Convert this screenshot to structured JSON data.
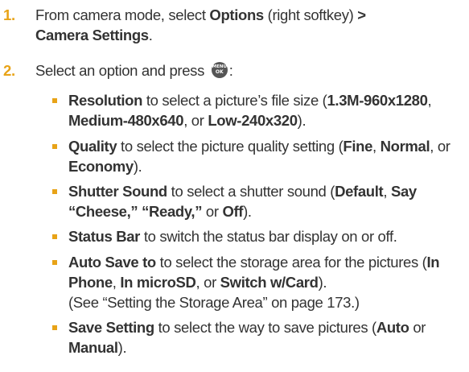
{
  "step1": {
    "number": "1.",
    "text_a": "From camera mode, select ",
    "options": "Options",
    "text_b": " (right softkey) ",
    "arrow": ">",
    "camera_settings": "Camera Settings",
    "period": "."
  },
  "step2": {
    "number": "2.",
    "text_a": "Select an option and press ",
    "key_line1": "MENU",
    "key_line2": "OK",
    "text_b": ":"
  },
  "bullets": {
    "resolution": {
      "title": "Resolution",
      "t1": " to select a picture’s file size (",
      "o1": "1.3M-960x1280",
      "s1": ", ",
      "o2": "Medium-480x640",
      "s2": ", or ",
      "o3": "Low-240x320",
      "end": ")."
    },
    "quality": {
      "title": "Quality",
      "t1": " to select the picture quality setting (",
      "o1": "Fine",
      "s1": ", ",
      "o2": "Normal",
      "s2": ", or ",
      "o3": "Economy",
      "end": ")."
    },
    "shutter": {
      "title": "Shutter Sound",
      "t1": " to select a shutter sound (",
      "o1": "Default",
      "s1": ", ",
      "o2": "Say “Cheese,”",
      "s2": " ",
      "o3": "“Ready,”",
      "s3": " or ",
      "o4": "Off",
      "end": ")."
    },
    "status_bar": {
      "title": "Status Bar",
      "t1": " to switch the status bar display on or off."
    },
    "auto_save": {
      "title": "Auto Save to",
      "t1": " to select the storage area for the pictures (",
      "o1": "In Phone",
      "s1": ", ",
      "o2": "In microSD",
      "s2": ", or ",
      "o3": "Switch w/Card",
      "end": ").",
      "note": "(See “Setting the Storage Area” on page 173.)"
    },
    "save_setting": {
      "title": "Save Setting",
      "t1": " to select the way to save pictures (",
      "o1": "Auto",
      "s1": " or ",
      "o2": "Manual",
      "end": ")."
    }
  },
  "colors": {
    "accent": "#e8a317",
    "text": "#333333",
    "key_icon": "#555555"
  },
  "icons": {
    "key": "menu-ok-key-icon",
    "bullet": "square-bullet"
  }
}
